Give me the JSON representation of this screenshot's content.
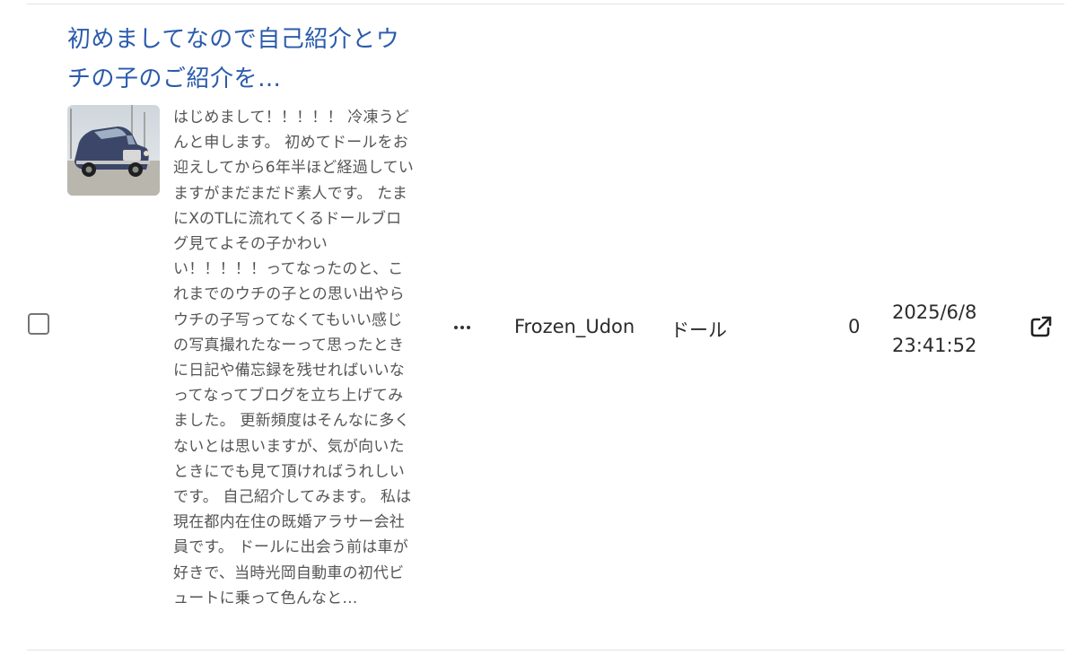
{
  "row": {
    "title": "初めましてなので自己紹介とウチの子のご紹介を…",
    "excerpt": "はじめまして！！！！！ 冷凍うどんと申します。 初めてドールをお迎えしてから6年半ほど経過していますがまだまだド素人です。 たまにXのTLに流れてくるドールブログ見てよその子かわいい！！！！！ってなったのと、これまでのウチの子との思い出やらウチの子写ってなくてもいい感じの写真撮れたなーって思ったときに日記や備忘録を残せればいいなってなってブログを立ち上げてみました。 更新頻度はそんなに多くないとは思いますが、気が向いたときにでも見て頂ければうれしいです。 自己紹介してみます。 私は現在都内在住の既婚アラサー会社員です。 ドールに出会う前は車が好きで、当時光岡自動車の初代ビュートに乗って色んなと…",
    "author": "Frozen_Udon",
    "category": "ドール",
    "count": "0",
    "date": "2025/6/8",
    "time": "23:41:52",
    "icons": {
      "more": "more-horizontal-icon",
      "external": "external-link-icon"
    },
    "colors": {
      "title": "#2a5bab",
      "text": "#2b2b2b"
    }
  }
}
